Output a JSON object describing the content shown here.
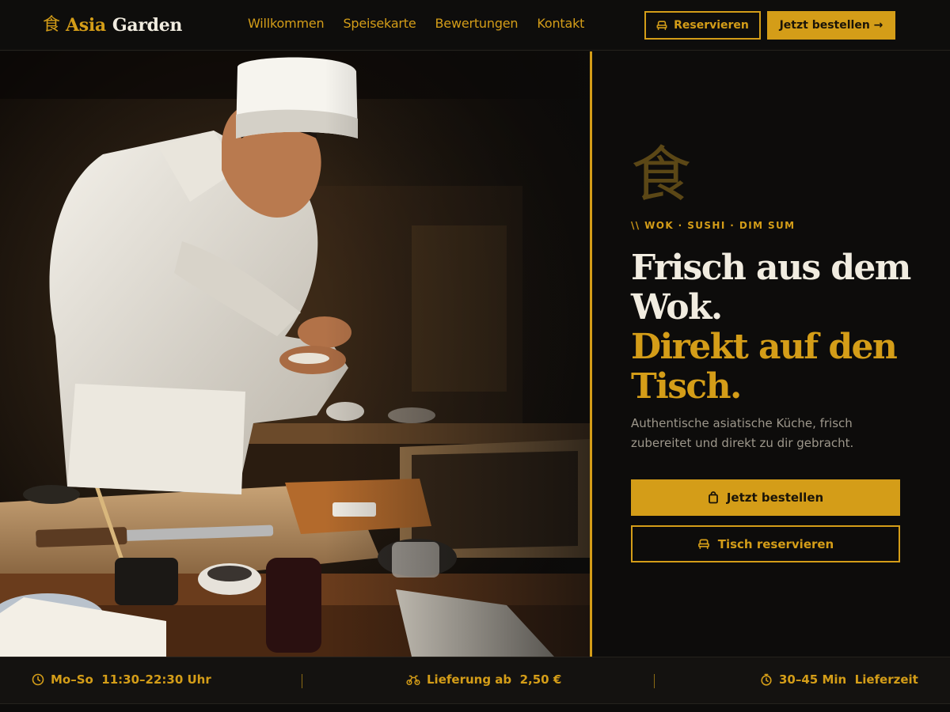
{
  "brand": {
    "glyph": "食",
    "name_part1": "Asia",
    "name_part2": "Garden"
  },
  "nav": {
    "items": [
      "Willkommen",
      "Speisekarte",
      "Bewertungen",
      "Kontakt"
    ]
  },
  "header_actions": {
    "reserve_label": "Reservieren",
    "order_label": "Jetzt bestellen →"
  },
  "hero": {
    "decorative_glyph": "食",
    "eyebrow": "\\\\ WOK · SUSHI · DIM SUM",
    "headline_line1": "Frisch aus dem Wok.",
    "headline_line2": "Direkt auf den Tisch.",
    "lead": "Authentische asiatische Küche, frisch zubereitet und direkt zu dir gebracht.",
    "primary_button": "Jetzt bestellen",
    "secondary_button": "Tisch reservieren"
  },
  "info_bar": {
    "hours_label": "Mo–So  11:30–22:30 Uhr",
    "delivery_label": "Lieferung ab  2,50 €",
    "time_label": "30–45 Min  Lieferzeit"
  },
  "colors": {
    "accent": "#d49d18",
    "background": "#0d0c0b",
    "text_light": "#f1ece0",
    "text_muted": "#9d978b"
  },
  "icons": {
    "order": "bag-icon",
    "reserve": "chair-icon",
    "hours": "clock-icon",
    "delivery": "bike-icon",
    "time": "stopwatch-icon"
  }
}
